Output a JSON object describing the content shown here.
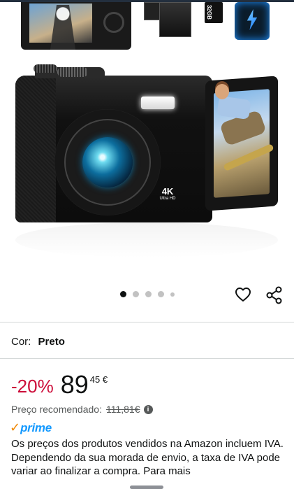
{
  "product": {
    "image_alt": "Câmara digital 4K preta com ecrã rotativo",
    "camera_badge": {
      "main": "4K",
      "sub": "Ultra HD"
    },
    "sd_label": "32GB",
    "gallery_dots": 5,
    "active_dot": 0
  },
  "color": {
    "label": "Cor:",
    "value": "Preto"
  },
  "price": {
    "discount": "-20%",
    "whole": "89",
    "fraction": "45 €",
    "reference_label": "Preço recomendado:",
    "reference_value": "111,81€",
    "info_icon": "i"
  },
  "prime": {
    "check": "✓",
    "label": "prime"
  },
  "description": "Os preços dos produtos vendidos na Amazon incluem IVA. Dependendo da sua morada de envio, a taxa de IVA pode variar ao finalizar a compra. Para mais",
  "colors": {
    "discount": "#cc0c39",
    "prime_blue": "#1399ff",
    "prime_check": "#f08804"
  }
}
